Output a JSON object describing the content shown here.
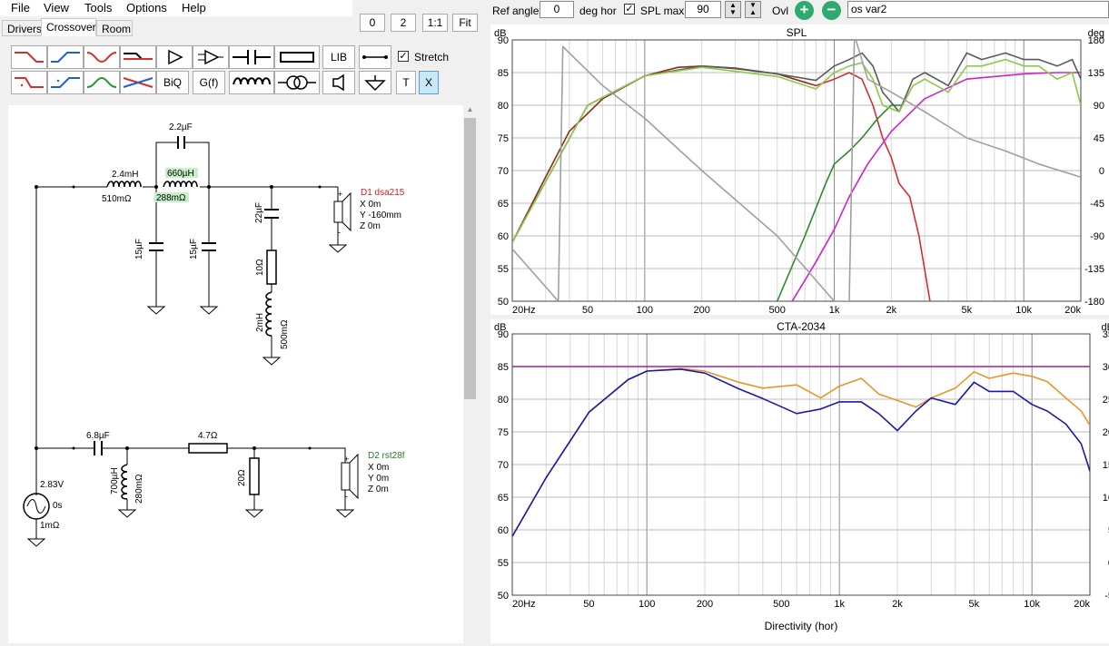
{
  "menu": {
    "file": "File",
    "view": "View",
    "tools": "Tools",
    "options": "Options",
    "help": "Help"
  },
  "view_buttons": {
    "zero": "0",
    "two": "2",
    "one_to_one": "1:1",
    "fit": "Fit"
  },
  "tabs": {
    "drivers": "Drivers",
    "crossover": "Crossover",
    "room": "Room"
  },
  "toolbar": {
    "lib": "LIB",
    "biq": "BiQ",
    "gf": "G(f)",
    "t": "T",
    "x": "X",
    "stretch": "Stretch",
    "stretch_checked": "✓"
  },
  "top_controls": {
    "ref_angle_label": "Ref angle",
    "ref_angle_value": "0",
    "deg_hor": "deg hor",
    "spl_max_label": "SPL max",
    "spl_max_checked": "✓",
    "spl_max_value": "90",
    "ovl_label": "Ovl",
    "ovl_name": "os var2"
  },
  "schematic": {
    "c_bypass": "2.2µF",
    "l1": "2.4mH",
    "l1_r": "510mΩ",
    "l2": "660µH",
    "l2_r": "288mΩ",
    "c1": "15µF",
    "c2": "15µF",
    "c3": "22µF",
    "r1": "10Ω",
    "l3": "2mH",
    "l3_r": "500mΩ",
    "d1_name": "D1 dsa215",
    "d1_x": "X 0m",
    "d1_y": "Y -160mm",
    "d1_z": "Z 0m",
    "c4": "6.8µF",
    "l4": "700µH",
    "l4_r": "280mΩ",
    "r2": "4.7Ω",
    "r3": "20Ω",
    "d2_name": "D2 rst28f",
    "d2_x": "X 0m",
    "d2_y": "Y 0m",
    "d2_z": "Z 0m",
    "src_v": "2.83V",
    "src_t": "0s",
    "src_r": "1mΩ",
    "plus": "+",
    "minus": "-"
  },
  "colors": {
    "accent_green": "#2eaa6e",
    "d1_label": "#d02020",
    "d2_label": "#2a7a2a",
    "highlight": "#c8f0c8"
  },
  "chart_data": [
    {
      "type": "line",
      "title": "SPL",
      "ylabel": "dB",
      "y2label": "deg",
      "x_ticks": [
        "20Hz",
        "50",
        "100",
        "200",
        "500",
        "1k",
        "2k",
        "5k",
        "10k",
        "20k"
      ],
      "y_ticks": [
        "90",
        "85",
        "80",
        "75",
        "70",
        "65",
        "60",
        "55",
        "50"
      ],
      "y2_ticks": [
        "180",
        "135",
        "90",
        "45",
        "0",
        "-45",
        "-90",
        "-135",
        "-180"
      ],
      "xlim": [
        20,
        20000
      ],
      "ylim": [
        50,
        90
      ],
      "y2lim": [
        -180,
        180
      ],
      "xscale": "log",
      "grid": true,
      "series": [
        {
          "color": "#8b2a1a",
          "x": [
            20,
            30,
            40,
            60,
            100,
            150,
            200,
            300,
            500,
            800
          ],
          "y": [
            59,
            69,
            76,
            81,
            84.5,
            85.8,
            86,
            85.7,
            84.8,
            83
          ]
        },
        {
          "color": "#d03030",
          "x": [
            800,
            1000,
            1200,
            1400,
            1600,
            1800,
            2000,
            2200,
            2500,
            2800,
            3200
          ],
          "y": [
            83,
            84,
            85,
            84,
            80,
            75,
            72,
            68,
            66,
            60,
            50
          ]
        },
        {
          "color": "#2a8a2a",
          "x": [
            500,
            700,
            900,
            1000,
            1200,
            1400,
            1700,
            2000,
            2300
          ],
          "y": [
            50,
            60,
            68,
            71,
            73,
            75,
            78,
            80,
            80
          ]
        },
        {
          "color": "#d020d0",
          "x": [
            600,
            800,
            1000,
            1200,
            1500,
            2000,
            3000,
            5000,
            10000,
            15000,
            20000
          ],
          "y": [
            50,
            56,
            61,
            66,
            71,
            76,
            81,
            84,
            84.8,
            85,
            85
          ]
        },
        {
          "color": "#5a5a5a",
          "x": [
            20,
            50,
            100,
            200,
            300,
            500,
            800,
            1000,
            1200,
            1400,
            1600,
            1800,
            2200,
            2600,
            3000,
            4000,
            5000,
            6000,
            8000,
            10000,
            12000,
            15000,
            18000,
            20000
          ],
          "y": [
            59,
            80,
            84.5,
            86,
            85.6,
            84.8,
            83.8,
            86,
            87,
            88,
            86,
            82,
            79,
            84,
            85,
            83,
            88,
            87,
            88,
            87,
            87,
            86,
            87,
            84
          ]
        },
        {
          "color": "#8cc84a",
          "x": [
            20,
            50,
            100,
            200,
            300,
            500,
            800,
            1000,
            1200,
            1400,
            1600,
            1800,
            2200,
            2600,
            3000,
            4000,
            5000,
            6000,
            8000,
            10000,
            12000,
            15000,
            18000,
            20000
          ],
          "y": [
            59,
            80,
            84.5,
            85.8,
            85.2,
            84.4,
            82.5,
            85,
            86,
            86.5,
            84,
            80,
            79,
            83,
            84,
            82,
            86,
            86,
            87,
            86,
            86,
            84,
            85,
            80
          ]
        },
        {
          "color": "#a0a0a0",
          "x": [
            20,
            35,
            37,
            40,
            60,
            100,
            200,
            500,
            1000,
            1200,
            1280,
            1300,
            1500,
            2000,
            3000,
            5000,
            8000,
            12000,
            20000
          ],
          "y": [
            58,
            50,
            89,
            88,
            83,
            78,
            70,
            60,
            50,
            50,
            92,
            90,
            84,
            82,
            79,
            75,
            73,
            71,
            69
          ]
        }
      ]
    },
    {
      "type": "line",
      "title": "CTA-2034",
      "ylabel": "dB",
      "y2label": "dB",
      "xlabel": "Directivity (hor)",
      "x_ticks": [
        "20Hz",
        "50",
        "100",
        "200",
        "500",
        "1k",
        "2k",
        "5k",
        "10k",
        "20k"
      ],
      "y_ticks": [
        "90",
        "85",
        "80",
        "75",
        "70",
        "65",
        "60",
        "55",
        "50"
      ],
      "y2_ticks": [
        "35",
        "30",
        "25",
        "20",
        "15",
        "10",
        "5",
        "0",
        "-5"
      ],
      "xlim": [
        20,
        20000
      ],
      "ylim": [
        50,
        90
      ],
      "y2lim": [
        -5,
        35
      ],
      "xscale": "log",
      "grid": true,
      "series": [
        {
          "color": "#e8962a",
          "x": [
            20,
            30,
            50,
            80,
            100,
            150,
            200,
            300,
            400,
            600,
            800,
            1000,
            1300,
            1600,
            2000,
            2500,
            3000,
            4000,
            5000,
            6000,
            8000,
            10000,
            12000,
            15000,
            18000,
            20000
          ],
          "y": [
            59,
            68,
            78,
            83,
            84.3,
            84.7,
            84.3,
            82.6,
            81.7,
            82.2,
            80.2,
            82,
            83.2,
            80.8,
            79.8,
            78.8,
            80.2,
            81.7,
            84.2,
            83.2,
            84,
            83.5,
            82.7,
            80.2,
            78.2,
            76
          ]
        },
        {
          "color": "#1a1aa8",
          "x": [
            20,
            30,
            50,
            80,
            100,
            150,
            200,
            300,
            400,
            600,
            800,
            1000,
            1300,
            1600,
            2000,
            2500,
            3000,
            4000,
            5000,
            6000,
            8000,
            10000,
            12000,
            15000,
            18000,
            20000
          ],
          "y": [
            59,
            68,
            78,
            83,
            84.3,
            84.6,
            84,
            81.6,
            80.1,
            77.8,
            78.5,
            79.6,
            79.6,
            77.8,
            75.2,
            78.2,
            80.2,
            79.2,
            82.6,
            81.2,
            81.2,
            79.2,
            78.2,
            76.2,
            73.2,
            69
          ]
        },
        {
          "color": "#a020a0",
          "x": [
            20,
            20000
          ],
          "y": [
            85,
            85
          ]
        }
      ]
    }
  ]
}
